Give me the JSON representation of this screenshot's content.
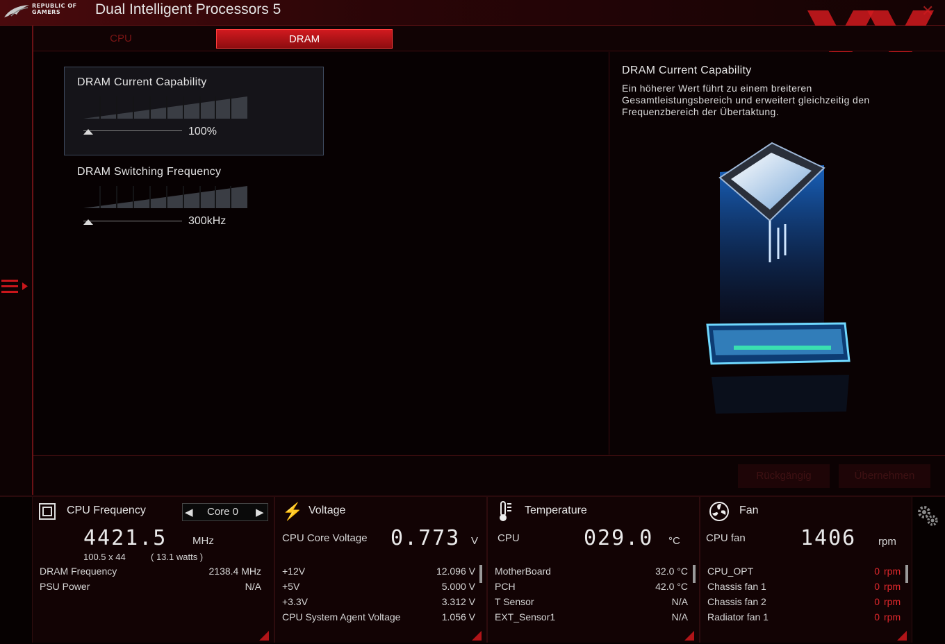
{
  "app": {
    "brand_line1": "REPUBLIC OF",
    "brand_line2": "GAMERS",
    "title": "Dual Intelligent Processors 5",
    "close_icon": "close-icon"
  },
  "tabs": [
    {
      "label": "CPU",
      "active": false
    },
    {
      "label": "DRAM",
      "active": true
    }
  ],
  "settings": [
    {
      "label": "DRAM Current Capability",
      "value": "100%",
      "selected": true
    },
    {
      "label": "DRAM Switching Frequency",
      "value": "300kHz",
      "selected": false
    }
  ],
  "description": {
    "title": "DRAM Current Capability",
    "text": "Ein höherer Wert führt zu einem breiteren Gesamtleistungsbereich und erweitert gleichzeitig den Frequenzbereich der Übertaktung."
  },
  "actions": {
    "undo": "Rückgängig",
    "apply": "Übernehmen"
  },
  "monitor": {
    "cpu_frequency": {
      "title": "CPU Frequency",
      "core": "Core 0",
      "value": "4421.5",
      "unit": "MHz",
      "multiplier": "100.5  x  44",
      "watts": "( 13.1 watts )",
      "rows": [
        {
          "label": "DRAM Frequency",
          "value": "2138.4  MHz"
        },
        {
          "label": "PSU Power",
          "value": "N/A"
        }
      ]
    },
    "voltage": {
      "title": "Voltage",
      "main_label": "CPU Core Voltage",
      "value": "0.773",
      "unit": "V",
      "rows": [
        {
          "label": "+12V",
          "value": "12.096  V"
        },
        {
          "label": "+5V",
          "value": "5.000  V"
        },
        {
          "label": "+3.3V",
          "value": "3.312  V"
        },
        {
          "label": "CPU System Agent Voltage",
          "value": "1.056  V"
        }
      ]
    },
    "temperature": {
      "title": "Temperature",
      "main_label": "CPU",
      "value": "029.0",
      "unit": "°C",
      "rows": [
        {
          "label": "MotherBoard",
          "value": "32.0 °C"
        },
        {
          "label": "PCH",
          "value": "42.0 °C"
        },
        {
          "label": "T Sensor",
          "value": "N/A"
        },
        {
          "label": "EXT_Sensor1",
          "value": "N/A"
        }
      ]
    },
    "fan": {
      "title": "Fan",
      "main_label": "CPU fan",
      "value": "1406",
      "unit": "rpm",
      "rows": [
        {
          "label": "CPU_OPT",
          "value": "0",
          "unit": "rpm"
        },
        {
          "label": "Chassis fan 1",
          "value": "0",
          "unit": "rpm"
        },
        {
          "label": "Chassis fan 2",
          "value": "0",
          "unit": "rpm"
        },
        {
          "label": "Radiator fan 1",
          "value": "0",
          "unit": "rpm"
        }
      ]
    }
  },
  "colors": {
    "accent": "#d11a1f",
    "background": "#0b0203",
    "highlight_text": "#e0282c"
  }
}
